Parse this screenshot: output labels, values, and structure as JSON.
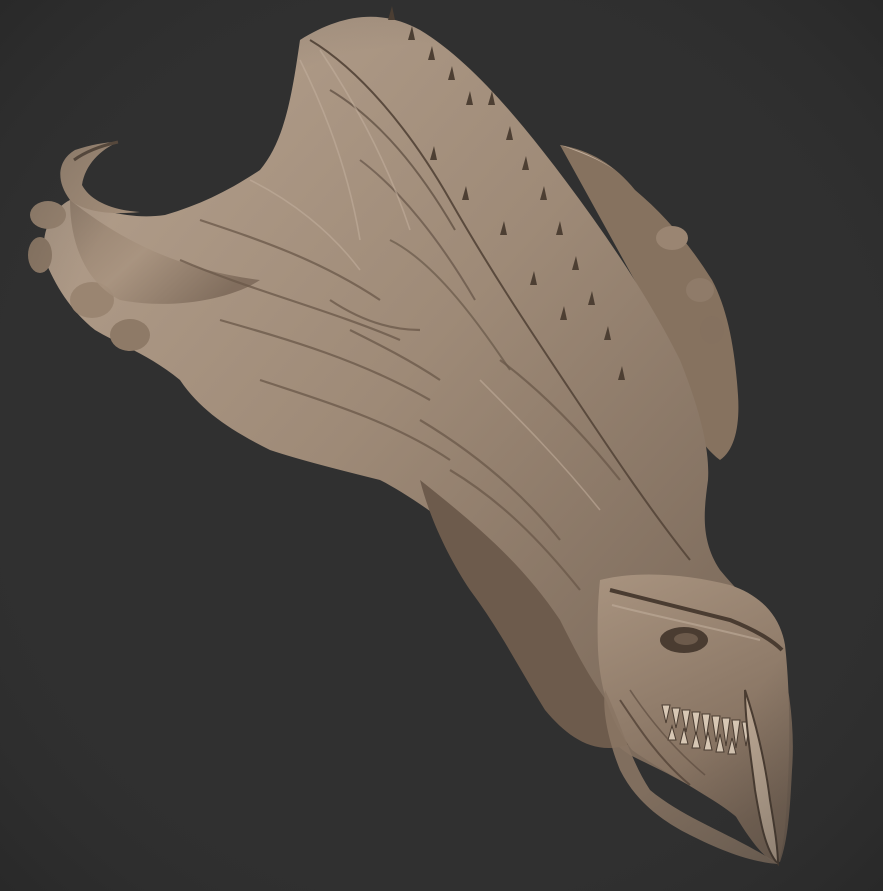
{
  "viewport": {
    "background_color": "#303030",
    "model_color": "#9c8774",
    "model_highlight": "#b9a694",
    "model_shadow": "#5f4f42",
    "model_deep_shadow": "#3f342c"
  },
  "subject": {
    "parts": [
      "head-crest",
      "spine-ridge",
      "left-horn",
      "right-horn",
      "eye-socket",
      "teeth",
      "lower-jaw"
    ]
  }
}
